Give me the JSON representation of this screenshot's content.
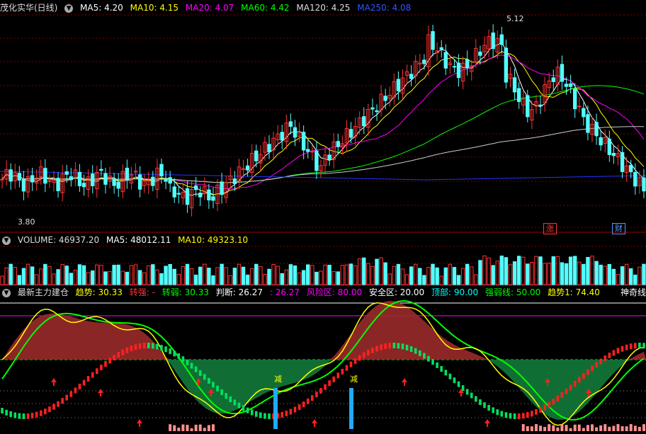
{
  "top": {
    "title": "茂化实华(日线)",
    "ma": [
      {
        "label": "MA5: 4.20",
        "color": "#ffffff"
      },
      {
        "label": "MA10: 4.15",
        "color": "#ffff00"
      },
      {
        "label": "MA20: 4.07",
        "color": "#ff00ff"
      },
      {
        "label": "MA60: 4.42",
        "color": "#00ff00"
      },
      {
        "label": "MA120: 4.25",
        "color": "#dddddd"
      },
      {
        "label": "MA250: 4.08",
        "color": "#3355ff"
      }
    ],
    "high_label": "5.12",
    "low_label": "3.80",
    "tag_zhang": "涨",
    "tag_cai": "财"
  },
  "volume": {
    "title": "VOLUME: 46937.20",
    "ma5": "MA5: 48012.11",
    "ma10": "MA10: 49323.10"
  },
  "indicator": {
    "name": "最新主力建仓",
    "items": [
      {
        "label": "趋势: 30.33",
        "color": "#ffff00"
      },
      {
        "label": "转强: -",
        "color": "#ff3333"
      },
      {
        "label": "转弱: 30.33",
        "color": "#00ff00"
      },
      {
        "label": "判断: 26.27",
        "color": "#ffffff"
      },
      {
        "label": ": 26.27",
        "color": "#ff00ff"
      },
      {
        "label": "风险区: 80.00",
        "color": "#ff00ff"
      },
      {
        "label": "安全区: 20.00",
        "color": "#ffffff"
      },
      {
        "label": "顶部: 90.00",
        "color": "#00ffff"
      },
      {
        "label": "强弱线: 50.00",
        "color": "#00ff00"
      },
      {
        "label": "趋势1: 74.40",
        "color": "#ffff00"
      }
    ],
    "right_label": "神奇线",
    "reduce_label": "减"
  },
  "colors": {
    "up": "#ff3333",
    "down": "#54ffff",
    "grid": "#800000"
  }
}
